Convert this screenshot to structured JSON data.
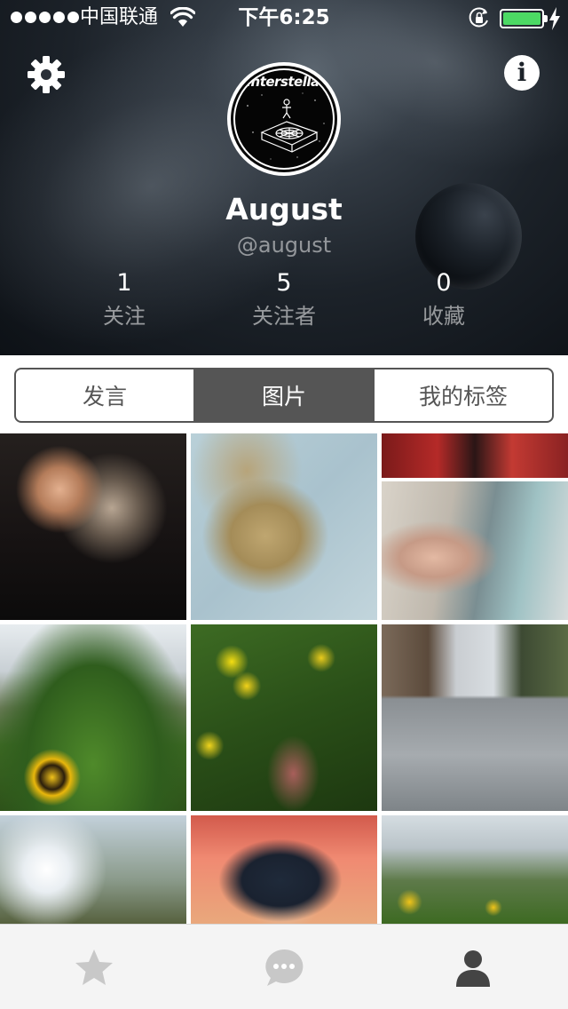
{
  "status_bar": {
    "carrier": "中国联通",
    "time": "下午6:25",
    "battery_level": 1.0,
    "battery_color": "#4cd964"
  },
  "header": {
    "settings_icon": "gear-icon",
    "info_icon": "info-icon",
    "info_glyph": "i",
    "avatar_text": "Interstellar"
  },
  "profile": {
    "name": "August",
    "handle": "@august"
  },
  "stats": [
    {
      "value": "1",
      "label": "关注"
    },
    {
      "value": "5",
      "label": "关注者"
    },
    {
      "value": "0",
      "label": "收藏"
    }
  ],
  "segments": {
    "items": [
      "发言",
      "图片",
      "我的标签"
    ],
    "selected": "图片"
  },
  "tabbar": {
    "items": [
      "star-icon",
      "chat-bubble-icon",
      "person-icon"
    ],
    "active": "person-icon"
  },
  "colors": {
    "segment_active": "#555555",
    "tab_inactive": "#c8c8c8",
    "tab_active": "#444444"
  }
}
